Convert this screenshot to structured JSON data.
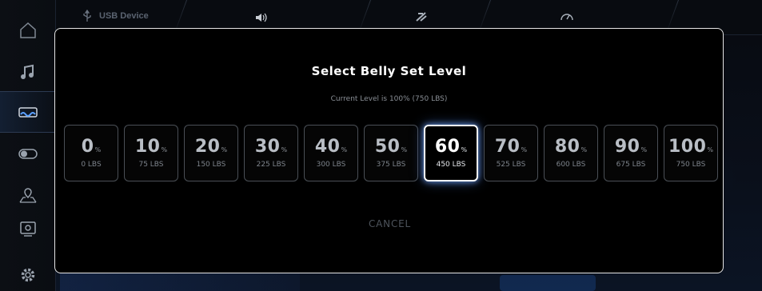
{
  "topbar": {
    "usb_label": "USB Device",
    "icons": [
      "usb-icon",
      "volume-icon",
      "ballast-icon",
      "gauge-icon"
    ]
  },
  "sidebar": {
    "items": [
      {
        "name": "home-icon"
      },
      {
        "name": "music-icon"
      },
      {
        "name": "wave-icon",
        "active": true
      },
      {
        "name": "toggle-icon"
      },
      {
        "name": "map-pin-icon"
      },
      {
        "name": "camera-icon"
      },
      {
        "name": "settings-icon"
      }
    ]
  },
  "modal": {
    "title": "Select Belly Set Level",
    "subtitle": "Current Level is 100% (750 LBS)",
    "unit": "%",
    "levels": [
      {
        "pct": "0",
        "lbs": "0 LBS"
      },
      {
        "pct": "10",
        "lbs": "75 LBS"
      },
      {
        "pct": "20",
        "lbs": "150 LBS"
      },
      {
        "pct": "30",
        "lbs": "225 LBS"
      },
      {
        "pct": "40",
        "lbs": "300 LBS"
      },
      {
        "pct": "50",
        "lbs": "375 LBS"
      },
      {
        "pct": "60",
        "lbs": "450 LBS"
      },
      {
        "pct": "70",
        "lbs": "525 LBS"
      },
      {
        "pct": "80",
        "lbs": "600 LBS"
      },
      {
        "pct": "90",
        "lbs": "675 LBS"
      },
      {
        "pct": "100",
        "lbs": "750 LBS"
      }
    ],
    "selected_index": 6,
    "cancel_label": "CANCEL"
  },
  "colors": {
    "accent_glow": "#78aaff",
    "border": "#e6e6e6",
    "level_border": "#4a4f56"
  }
}
